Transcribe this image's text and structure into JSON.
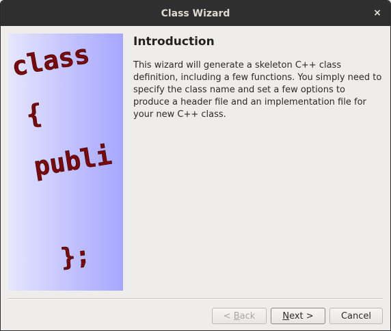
{
  "window": {
    "title": "Class Wizard",
    "close_glyph": "×"
  },
  "side_image": {
    "icon": "class-code-illustration",
    "lines": [
      "class",
      "{",
      "publi",
      "};"
    ]
  },
  "page": {
    "heading": "Introduction",
    "description": "This wizard will generate a skeleton C++ class definition, including a few functions. You simply need to specify the class name and set a few options to produce a header file and an implementation file for your new C++ class."
  },
  "buttons": {
    "back_prefix": "< ",
    "back_mnemonic": "B",
    "back_rest": "ack",
    "back_enabled": false,
    "next_mnemonic": "N",
    "next_rest": "ext >",
    "cancel": "Cancel"
  }
}
